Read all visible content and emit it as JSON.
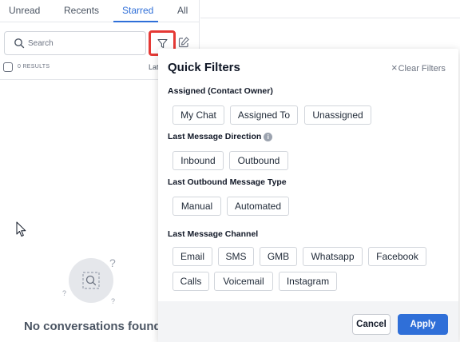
{
  "tabs": [
    {
      "label": "Unread"
    },
    {
      "label": "Recents"
    },
    {
      "label": "Starred"
    },
    {
      "label": "All"
    }
  ],
  "active_tab": "Starred",
  "search": {
    "placeholder": "Search"
  },
  "results": {
    "label": "0 RESULTS",
    "sort_label": "Lat"
  },
  "empty_state": {
    "text": "No conversations found"
  },
  "quick_filters": {
    "title": "Quick Filters",
    "clear_label": "Clear Filters",
    "assigned": {
      "label": "Assigned (Contact Owner)",
      "options": [
        "My Chat",
        "Assigned To",
        "Unassigned"
      ]
    },
    "direction": {
      "label": "Last Message Direction",
      "options": [
        "Inbound",
        "Outbound"
      ]
    },
    "outbound_type": {
      "label": "Last Outbound Message Type",
      "options": [
        "Manual",
        "Automated"
      ]
    },
    "channel": {
      "label": "Last Message Channel",
      "options": [
        "Email",
        "SMS",
        "GMB",
        "Whatsapp",
        "Facebook",
        "Calls",
        "Voicemail",
        "Instagram"
      ]
    },
    "cancel_label": "Cancel",
    "apply_label": "Apply"
  },
  "colors": {
    "accent": "#2f6fd8",
    "highlight": "#e53935"
  },
  "icons": [
    "search-icon",
    "filter-icon",
    "compose-icon",
    "close-icon",
    "info-icon",
    "empty-search-icon",
    "mouse-cursor-icon"
  ]
}
